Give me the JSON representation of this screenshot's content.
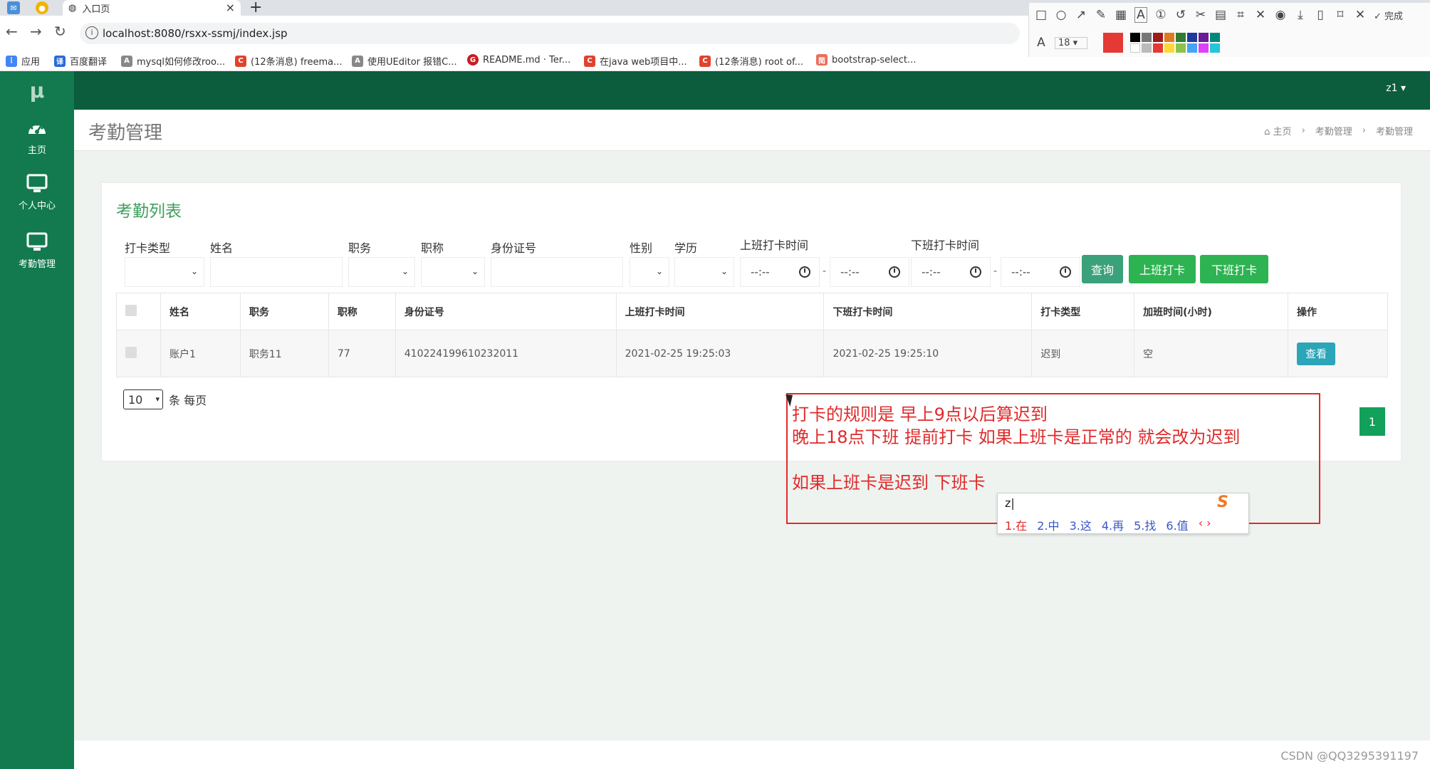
{
  "browser": {
    "tab_title": "入口页",
    "new_tab": "+",
    "url": "localhost:8080/rsxx-ssmj/index.jsp",
    "bookmarks": [
      {
        "label": "应用",
        "icon": "apps-grid-icon",
        "color": "#4285f4"
      },
      {
        "label": "百度翻译",
        "icon": "baidu-translate-icon",
        "color": "#2a6bd8"
      },
      {
        "label": "mysql如何修改roo...",
        "icon": "bookmark-icon",
        "color": "#666666"
      },
      {
        "label": "(12条消息) freema...",
        "icon": "csdn-icon",
        "color": "#e0432d"
      },
      {
        "label": "使用UEditor 报错C...",
        "icon": "bookmark-icon",
        "color": "#666666"
      },
      {
        "label": "README.md · Ter...",
        "icon": "gitee-icon",
        "color": "#c71d23"
      },
      {
        "label": "在java web项目中...",
        "icon": "csdn-icon",
        "color": "#e0432d"
      },
      {
        "label": "(12条消息) root of...",
        "icon": "csdn-icon",
        "color": "#e0432d"
      },
      {
        "label": "bootstrap-select...",
        "icon": "jianshu-icon",
        "color": "#ea6f5a"
      }
    ]
  },
  "snap_tool": {
    "font_size": "18",
    "done_label": "完成"
  },
  "app": {
    "logo": "μ",
    "user": "z1 ▾",
    "sidebar": [
      {
        "label": "主页",
        "icon": "dashboard-icon"
      },
      {
        "label": "个人中心",
        "icon": "monitor-icon"
      },
      {
        "label": "考勤管理",
        "icon": "monitor-icon"
      }
    ],
    "page_title": "考勤管理",
    "breadcrumb": [
      "主页",
      "考勤管理",
      "考勤管理"
    ]
  },
  "panel": {
    "title": "考勤列表",
    "filters": {
      "punch_type": "打卡类型",
      "name": "姓名",
      "position": "职务",
      "title": "职称",
      "id_number": "身份证号",
      "gender": "性别",
      "education": "学历",
      "clock_in_time": "上班打卡时间",
      "clock_out_time": "下班打卡时间",
      "time_placeholder": "--:--"
    },
    "buttons": {
      "query": "查询",
      "clock_in": "上班打卡",
      "clock_out": "下班打卡"
    },
    "table": {
      "headers": [
        "姓名",
        "职务",
        "职称",
        "身份证号",
        "上班打卡时间",
        "下班打卡时间",
        "打卡类型",
        "加班时间(小时)",
        "操作"
      ],
      "rows": [
        {
          "name": "账户1",
          "position": "职务11",
          "title": "77",
          "id_number": "410224199610232011",
          "clock_in": "2021-02-25 19:25:03",
          "clock_out": "2021-02-25 19:25:10",
          "punch_type": "迟到",
          "overtime": "空",
          "action": "查看"
        }
      ]
    },
    "pager": {
      "page_size": "10",
      "page_size_suffix": "条 每页",
      "current_page": "1"
    }
  },
  "annotation": {
    "lines": [
      "打卡的规则是  早上9点以后算迟到",
      "晚上18点下班  提前打卡  如果上班卡是正常的 就会改为迟到",
      "如果上班卡是迟到 下班卡"
    ],
    "ime_input": "z",
    "ime_candidates": [
      "1.在",
      "2.中",
      "3.这",
      "4.再",
      "5.找",
      "6.值"
    ]
  },
  "watermark": "CSDN @QQ3295391197",
  "colors": {
    "sidebar": "#127a4e",
    "topbar": "#0b5d3d",
    "accent_green": "#2eb352",
    "annotation_red": "#e02a2a"
  }
}
